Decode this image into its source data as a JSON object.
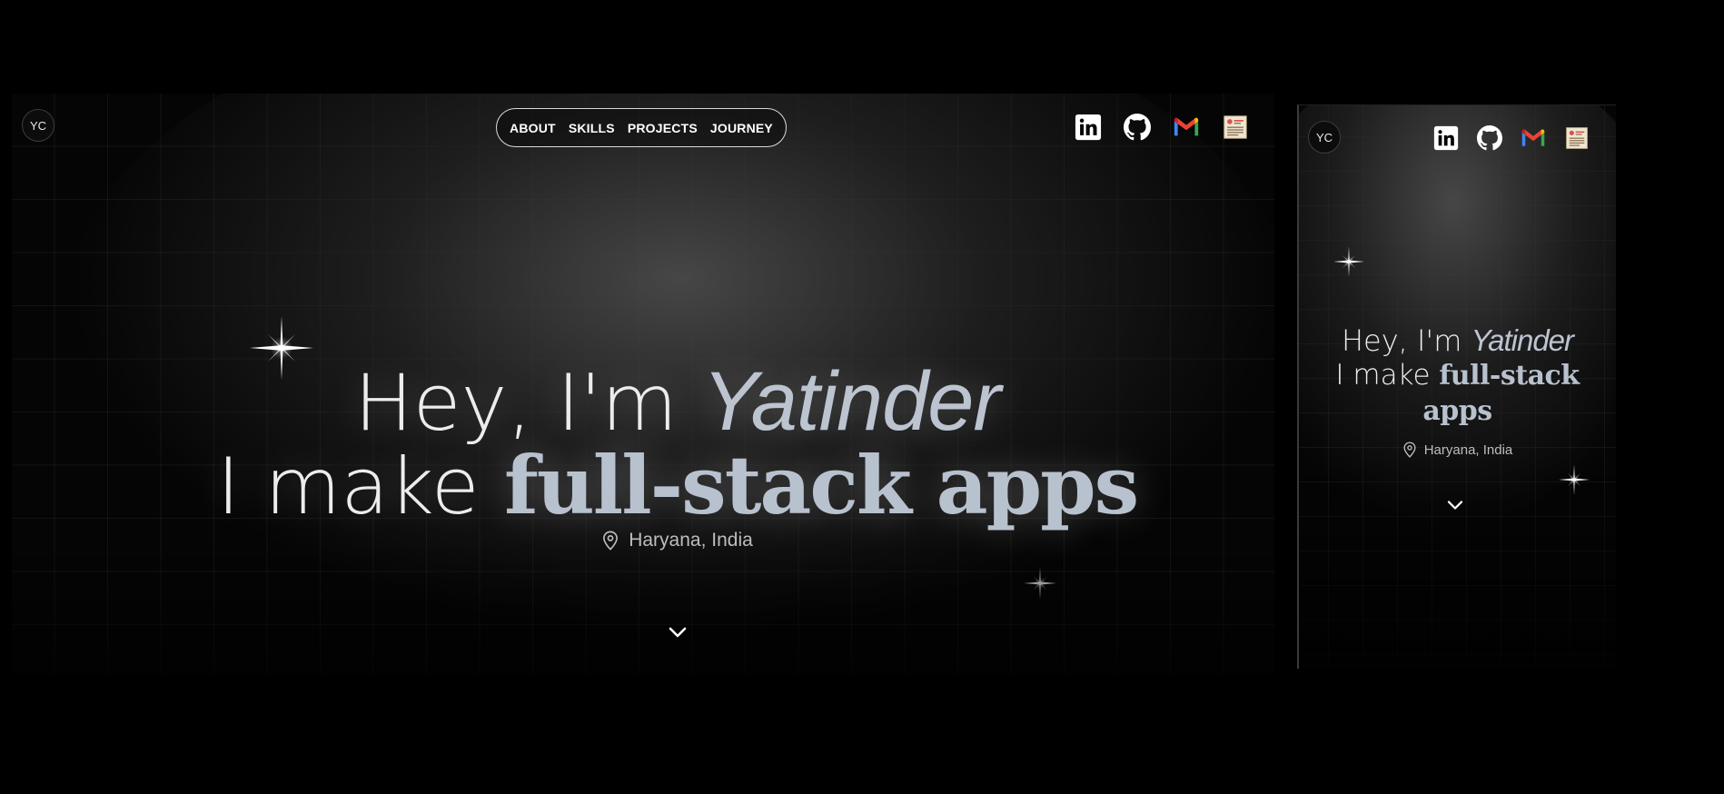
{
  "desktop": {
    "logo": "YC",
    "nav": [
      "ABOUT",
      "SKILLS",
      "PROJECTS",
      "JOURNEY"
    ],
    "socials": [
      "linkedin-icon",
      "github-icon",
      "gmail-icon",
      "resume-icon"
    ],
    "hero": {
      "greeting": "Hey, I'm ",
      "name": "Yatinder",
      "line2_prefix": "I make ",
      "line2_accent": "full-stack apps"
    },
    "location": "Haryana, India"
  },
  "mobile": {
    "logo": "YC",
    "socials": [
      "linkedin-icon",
      "github-icon",
      "gmail-icon",
      "resume-icon"
    ],
    "hero": {
      "greeting": "Hey, I'm ",
      "name": "Yatinder",
      "line2_prefix": "I make ",
      "line2_accent": "full-stack apps"
    },
    "location": "Haryana, India"
  },
  "colors": {
    "background": "#000000",
    "heading": "#ececec",
    "accent": "#b8c1ce",
    "linkedin": "#ffffff",
    "gmail_red": "#ea4335",
    "gmail_blue": "#4285f4",
    "gmail_green": "#34a853",
    "gmail_yellow": "#fbbc05"
  }
}
